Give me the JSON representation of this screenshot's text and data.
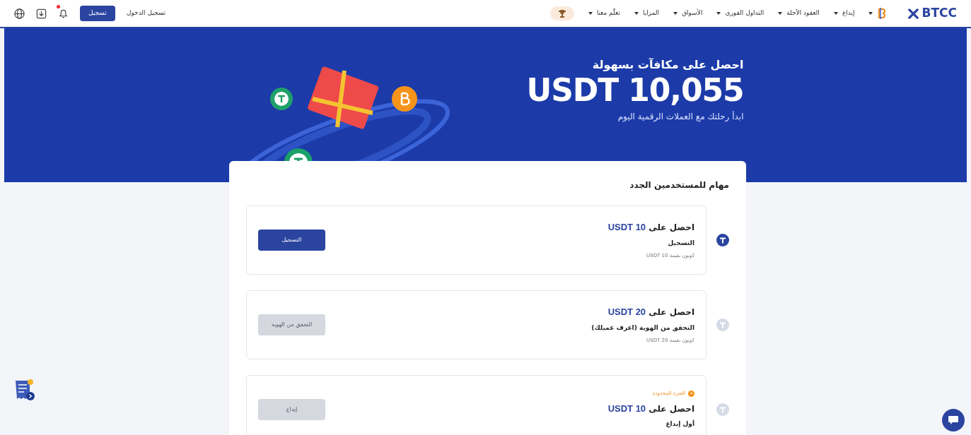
{
  "header": {
    "logo": "BTCC",
    "nav": [
      {
        "label": "إيداع",
        "has_menu": true
      },
      {
        "label": "العقود الآجلة",
        "has_menu": true
      },
      {
        "label": "التداول الفوري",
        "has_menu": true
      },
      {
        "label": "الأسواق",
        "has_menu": true
      },
      {
        "label": "المزايا",
        "has_menu": true
      },
      {
        "label": "تعلّم معنا",
        "has_menu": true
      }
    ],
    "login": "تسجيل الدخول",
    "signup": "تسجيل",
    "has_notification": true
  },
  "banner": {
    "heading": "احصل على مكافآت بسهولة",
    "amount": "USDT 10,055",
    "subtitle": "ابدأ رحلتك مع العملات الرقمية اليوم"
  },
  "tasks": {
    "title": "مهام للمستخدمين الجدد",
    "items": [
      {
        "prefix": "احصل على",
        "amount": "USDT 10",
        "name": "التسجيل",
        "coupon": "كوبون بقيمة USDT 10",
        "button": "التسجيل",
        "disabled": false
      },
      {
        "prefix": "احصل على",
        "amount": "USDT 20",
        "name": "التحقق من الهوية (اعرف عميلك)",
        "coupon": "كوبون بقيمة USDT 20",
        "button": "التحقق من الهوية",
        "disabled": true
      },
      {
        "badge": "الفترة المحدودة",
        "prefix": "احصل على",
        "amount": "USDT 10",
        "name": "أول إيداع",
        "button": "إيداع",
        "disabled": true
      }
    ]
  }
}
